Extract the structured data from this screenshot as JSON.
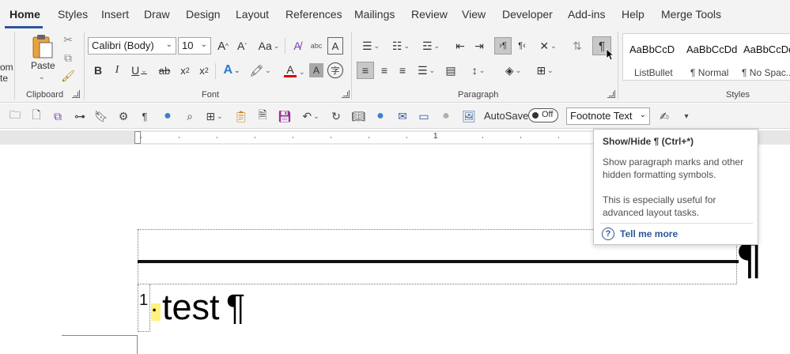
{
  "tabs": [
    "Home",
    "Styles",
    "Insert",
    "Draw",
    "Design",
    "Layout",
    "References",
    "Mailings",
    "Review",
    "View",
    "Developer",
    "Add-ins",
    "Help",
    "Merge Tools"
  ],
  "clipboard": {
    "cut_partial": "om",
    "paste_partial": "te",
    "paste_label": "Paste",
    "group_label": "Clipboard"
  },
  "font": {
    "name": "Calibri (Body)",
    "size": "10",
    "group_label": "Font",
    "bold": "B",
    "italic": "I",
    "underline": "U",
    "strike": "ab",
    "subscript": "x",
    "sub_char": "2",
    "superscript": "x",
    "sup_char": "2",
    "grow": "A",
    "shrink": "A",
    "case": "Aa"
  },
  "paragraph": {
    "group_label": "Paragraph",
    "show_hide_glyph": "¶"
  },
  "styles": {
    "group_label": "Styles",
    "items": [
      {
        "sample": "AaBbCcD",
        "name": "ListBullet"
      },
      {
        "sample": "AaBbCcDd",
        "name": "¶ Normal"
      },
      {
        "sample": "AaBbCcDd",
        "name": "¶ No Spac..."
      }
    ]
  },
  "qat": {
    "autosave_label": "AutoSave",
    "autosave_state": "Off",
    "style_value": "Footnote Text"
  },
  "ruler": {
    "mark": "1"
  },
  "document": {
    "separator_pilcrow": "¶",
    "footnote_number": "1",
    "footnote_space_mark": "·",
    "footnote_text": "test",
    "footnote_pilcrow": "¶"
  },
  "tooltip": {
    "title": "Show/Hide ¶ (Ctrl+*)",
    "desc1": "Show paragraph marks and other hidden formatting symbols.",
    "desc2": "This is especially useful for advanced layout tasks.",
    "help_icon": "?",
    "link": "Tell me more"
  },
  "colors": {
    "accent": "#2b579a",
    "font_color_bar": "#e00000",
    "highlight": "#fff27a"
  }
}
